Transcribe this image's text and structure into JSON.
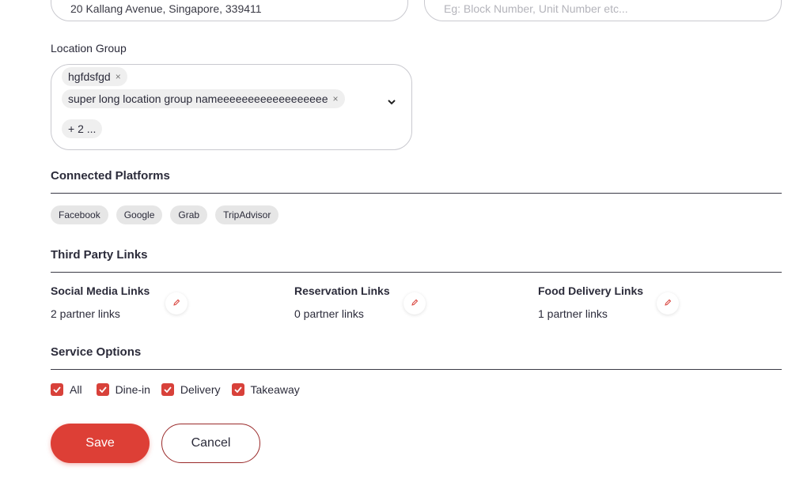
{
  "address": {
    "line1_value": "20 Kallang Avenue, Singapore, 339411",
    "line2_placeholder": "Eg: Block Number, Unit Number etc..."
  },
  "location_group": {
    "label": "Location Group",
    "chips": [
      "hgfdsfgd",
      "super long location group nameeeeeeeeeeeeeeeeee"
    ],
    "more": "+ 2 ...",
    "remove_glyph": "×"
  },
  "connected_platforms": {
    "title": "Connected Platforms",
    "items": [
      "Facebook",
      "Google",
      "Grab",
      "TripAdvisor"
    ]
  },
  "third_party_links": {
    "title": "Third Party Links",
    "columns": [
      {
        "title": "Social Media Links",
        "count": "2 partner links"
      },
      {
        "title": "Reservation Links",
        "count": "0 partner links"
      },
      {
        "title": "Food Delivery Links",
        "count": "1 partner links"
      }
    ]
  },
  "service_options": {
    "title": "Service Options",
    "items": [
      {
        "label": "All",
        "checked": true
      },
      {
        "label": "Dine-in",
        "checked": true
      },
      {
        "label": "Delivery",
        "checked": true
      },
      {
        "label": "Takeaway",
        "checked": true
      }
    ]
  },
  "actions": {
    "save": "Save",
    "cancel": "Cancel"
  },
  "colors": {
    "accent": "#dd3f36",
    "checkbox": "#d8413a",
    "border": "#c9c9cf"
  },
  "icons": {
    "edit": "pencil-icon",
    "remove": "close-icon",
    "dropdown": "chevron-down-icon",
    "check": "checkmark-icon"
  }
}
